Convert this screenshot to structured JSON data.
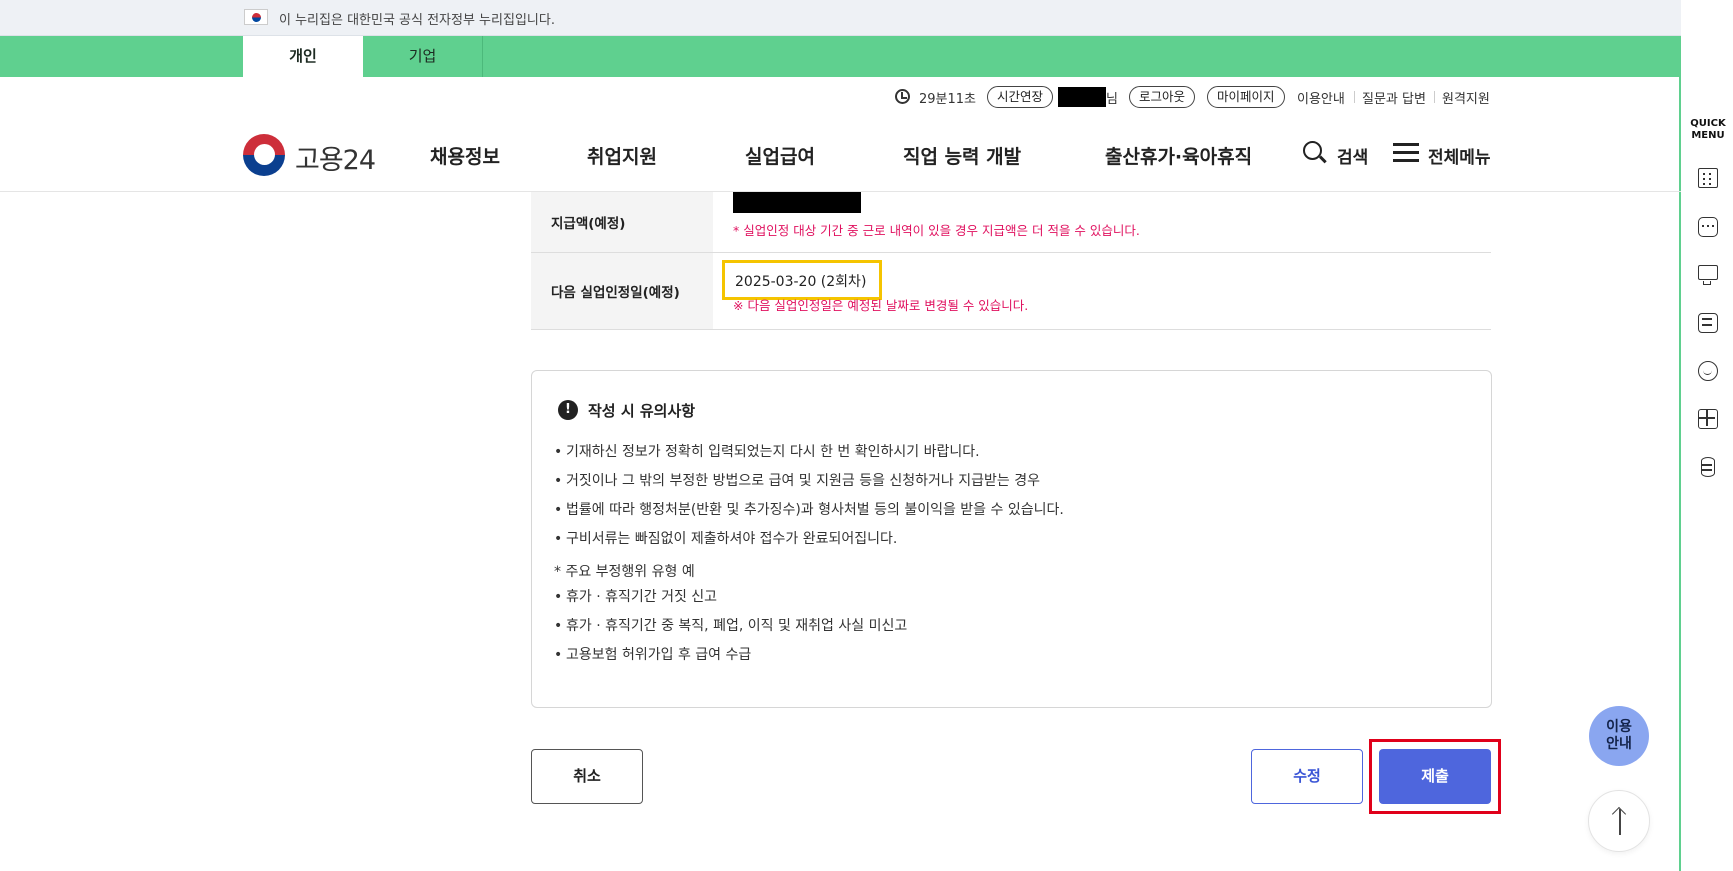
{
  "gov_banner": {
    "text": "이 누리집은 대한민국 공식 전자정부 누리집입니다."
  },
  "user_tabs": [
    {
      "label": "개인"
    },
    {
      "label": "기업"
    }
  ],
  "util": {
    "timer": "29분11초",
    "extend_label": "시간연장",
    "name_suffix": "님",
    "logout_label": "로그아웃",
    "mypage_label": "마이페이지",
    "guide_label": "이용안내",
    "qna_label": "질문과 답변",
    "remote_label": "원격지원"
  },
  "logo": {
    "text": "고용24"
  },
  "nav": {
    "items": [
      {
        "label": "채용정보"
      },
      {
        "label": "취업지원"
      },
      {
        "label": "실업급여"
      },
      {
        "label": "직업 능력 개발"
      },
      {
        "label": "출산휴가·육아휴직"
      }
    ],
    "search_label": "검색",
    "menu_label": "전체메뉴"
  },
  "table": {
    "rows": [
      {
        "header": "지급액(예정)",
        "note": "* 실업인정 대상 기간 중 근로 내역이 있을 경우 지급액은 더 적을 수 있습니다."
      },
      {
        "header": "다음 실업인정일(예정)",
        "value": "2025-03-20 (2회차)",
        "note": "※ 다음 실업인정일은 예정된 날짜로 변경될 수 있습니다."
      }
    ]
  },
  "notice": {
    "title": "작성 시 유의사항",
    "items": [
      "기재하신 정보가 정확히 입력되었는지 다시 한 번 확인하시기 바랍니다.",
      "거짓이나 그 밖의 부정한 방법으로 급여 및 지원금 등을 신청하거나 지급받는 경우",
      "법률에 따라 행정처분(반환 및 추가징수)과 형사처벌 등의 불이익을 받을 수 있습니다.",
      "구비서류는 빠짐없이 제출하셔야 접수가 완료되어집니다."
    ],
    "sub_title": "* 주요 부정행위 유형 예",
    "sub_items": [
      "휴가 · 휴직기간 거짓 신고",
      "휴가 · 휴직기간 중 복직, 폐업, 이직 및 재취업 사실 미신고",
      "고용보험 허위가입 후 급여 수급"
    ]
  },
  "buttons": {
    "cancel": "취소",
    "edit": "수정",
    "submit": "제출"
  },
  "floating": {
    "guide_line1": "이용",
    "guide_line2": "안내"
  },
  "quick_menu": {
    "title_line1": "QUICK",
    "title_line2": "MENU",
    "icons": [
      "building-icon",
      "chat-icon",
      "monitor-icon",
      "checklist-icon",
      "face-icon",
      "calculator-icon",
      "coins-icon"
    ]
  },
  "colors": {
    "green": "#5fd08f",
    "primary": "#4e66dd",
    "alert_red": "#e0115f",
    "highlight_yellow": "#f5c400",
    "annotation_red": "#e0001a"
  }
}
